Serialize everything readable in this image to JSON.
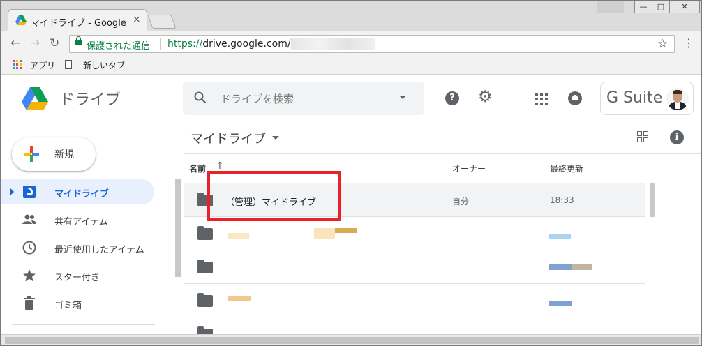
{
  "browser": {
    "tab_title": "マイドライブ - Google",
    "tab_close": "×",
    "window_buttons": [
      "—",
      "□",
      "✕"
    ],
    "nav": {
      "back": "←",
      "forward": "→",
      "reload": "↻"
    },
    "secure_label": "保護された通信",
    "url_scheme": "https://",
    "url_host": "drive.google.com/",
    "star": "☆",
    "menu": "⋮",
    "bookmarks": [
      "アプリ",
      "新しいタブ"
    ]
  },
  "header": {
    "product_name": "ドライブ",
    "search_placeholder": "ドライブを検索",
    "help": "?",
    "settings": "⚙",
    "gsuite_label": "G Suite"
  },
  "sidebar": {
    "new_label": "新規",
    "items": [
      {
        "label": "マイドライブ",
        "icon": "my-drive-icon",
        "active": true
      },
      {
        "label": "共有アイテム",
        "icon": "shared-icon",
        "active": false
      },
      {
        "label": "最近使用したアイテム",
        "icon": "clock-icon",
        "active": false
      },
      {
        "label": "スター付き",
        "icon": "star-icon",
        "active": false
      },
      {
        "label": "ゴミ箱",
        "icon": "trash-icon",
        "active": false
      }
    ]
  },
  "main": {
    "location": "マイドライブ",
    "info": "i",
    "columns": {
      "name": "名前",
      "sort": "↑",
      "owner": "オーナー",
      "modified": "最終更新"
    },
    "rows": [
      {
        "name": "（管理）マイドライブ",
        "owner": "自分",
        "modified": "18:33",
        "icon": "shared-folder-icon"
      },
      {
        "name": "",
        "owner": "",
        "modified": "",
        "icon": "shared-folder-icon"
      },
      {
        "name": "",
        "owner": "",
        "modified": "",
        "icon": "folder-icon"
      },
      {
        "name": "",
        "owner": "",
        "modified": "",
        "icon": "folder-icon"
      }
    ]
  },
  "colors": {
    "accent": "#1967d2",
    "highlight": "#e8212b",
    "secure": "#0b8043"
  }
}
